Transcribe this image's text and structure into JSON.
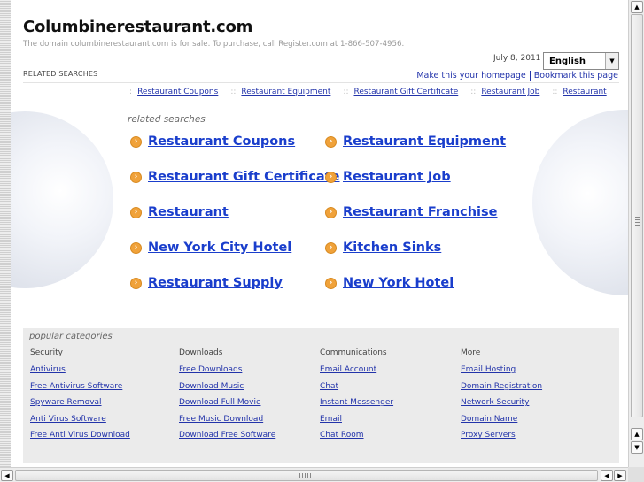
{
  "header": {
    "title": "Columbinerestaurant.com",
    "notice": "The domain columbinerestaurant.com is for sale. To purchase, call Register.com at 1-866-507-4956.",
    "date": "July 8, 2011",
    "language": "English",
    "related_label": "RELATED SEARCHES",
    "make_homepage": "Make this your homepage",
    "bookmark": "Bookmark this page"
  },
  "related_bar": {
    "separator": "::",
    "items": [
      "Restaurant Coupons",
      "Restaurant Equipment",
      "Restaurant Gift Certificate",
      "Restaurant Job",
      "Restaurant"
    ]
  },
  "related": {
    "heading": "related searches",
    "bullet": "›",
    "left": [
      "Restaurant Coupons",
      "Restaurant Gift Certificate",
      "Restaurant",
      "New York City Hotel",
      "Restaurant Supply"
    ],
    "right": [
      "Restaurant Equipment",
      "Restaurant Job",
      "Restaurant Franchise",
      "Kitchen Sinks",
      "New York Hotel"
    ]
  },
  "popular": {
    "heading": "popular categories",
    "columns": [
      {
        "title": "Security",
        "links": [
          "Antivirus",
          "Free Antivirus Software",
          "Spyware Removal",
          "Anti Virus Software",
          "Free Anti Virus Download"
        ]
      },
      {
        "title": "Downloads",
        "links": [
          "Free Downloads",
          "Download Music",
          "Download Full Movie",
          "Free Music Download",
          "Download Free Software"
        ]
      },
      {
        "title": "Communications",
        "links": [
          "Email Account",
          "Chat",
          "Instant Messenger",
          "Email",
          "Chat Room"
        ]
      },
      {
        "title": "More",
        "links": [
          "Email Hosting",
          "Domain Registration",
          "Network Security",
          "Domain Name",
          "Proxy Servers"
        ]
      }
    ]
  },
  "icons": {
    "dropdown": "chevron-down-icon",
    "scroll_up": "arrow-up-icon",
    "scroll_down": "arrow-down-icon",
    "scroll_left": "arrow-left-icon",
    "scroll_right": "arrow-right-icon"
  },
  "colors": {
    "link": "#1a3ecc",
    "bullet": "#f0a23a",
    "panel": "#ebebeb"
  }
}
